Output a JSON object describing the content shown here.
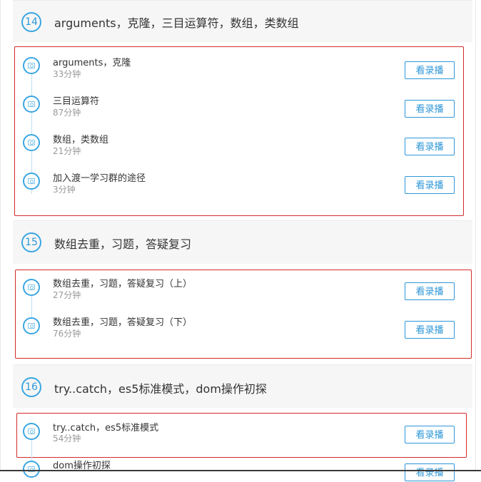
{
  "chapters": [
    {
      "number": "14",
      "title": "arguments，克隆，三目运算符，数组，类数组",
      "lessons": [
        {
          "title": "arguments，克隆",
          "duration": "33分钟",
          "button": "看录播"
        },
        {
          "title": "三目运算符",
          "duration": "87分钟",
          "button": "看录播"
        },
        {
          "title": "数组，类数组",
          "duration": "21分钟",
          "button": "看录播"
        },
        {
          "title": "加入渡一学习群的途径",
          "duration": "3分钟",
          "button": "看录播"
        }
      ]
    },
    {
      "number": "15",
      "title": "数组去重，习题，答疑复习",
      "lessons": [
        {
          "title": "数组去重，习题，答疑复习（上）",
          "duration": "27分钟",
          "button": "看录播"
        },
        {
          "title": "数组去重，习题，答疑复习（下）",
          "duration": "76分钟",
          "button": "看录播"
        }
      ]
    },
    {
      "number": "16",
      "title": "try..catch，es5标准模式，dom操作初探",
      "lessons": [
        {
          "title": "try..catch，es5标准模式",
          "duration": "54分钟",
          "button": "看录播"
        },
        {
          "title": "dom操作初探",
          "duration": "",
          "button": "看录播"
        }
      ]
    }
  ]
}
